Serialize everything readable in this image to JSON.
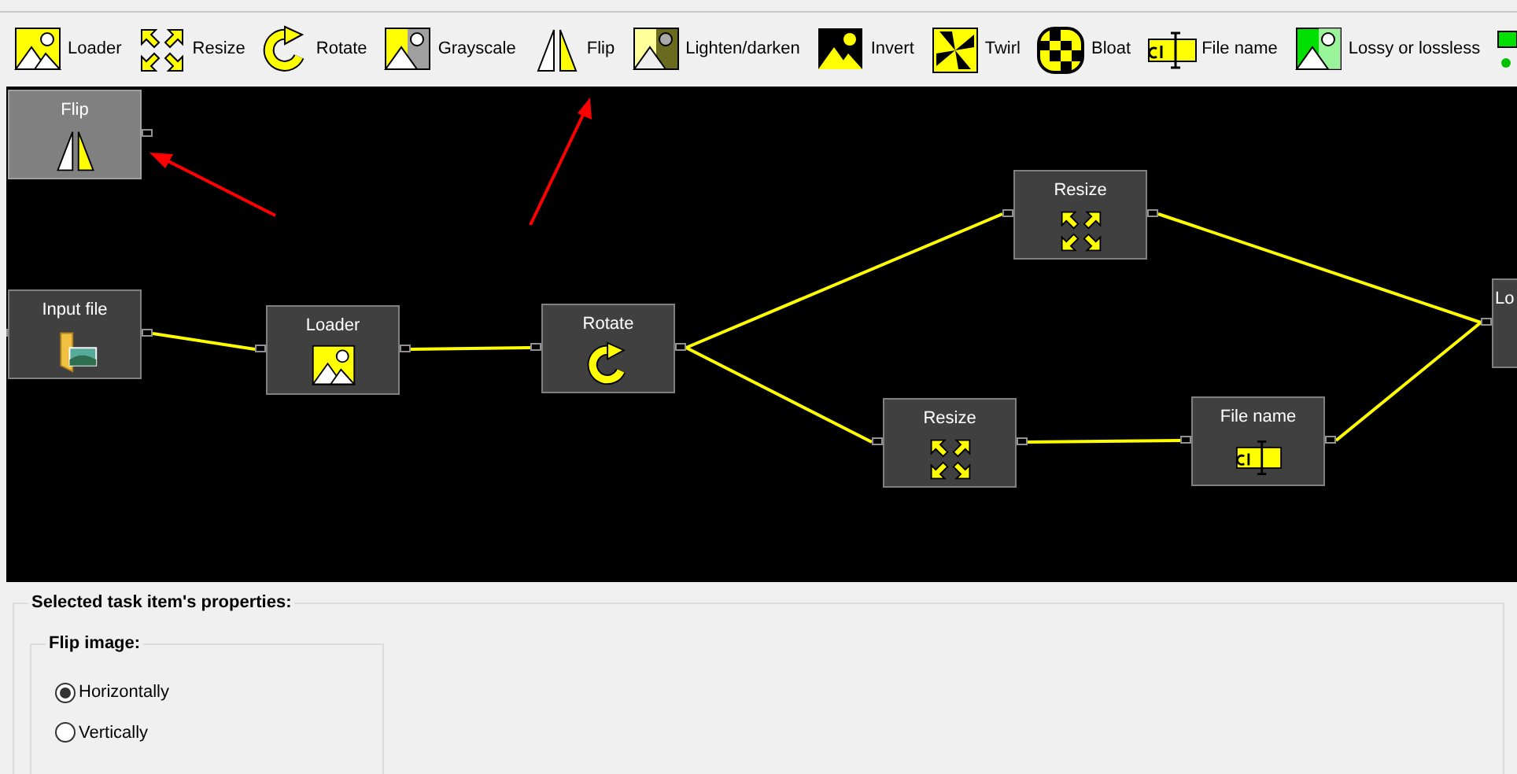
{
  "toolbar": [
    {
      "label": "Loader",
      "kind": "loader"
    },
    {
      "label": "Resize",
      "kind": "resize"
    },
    {
      "label": "Rotate",
      "kind": "rotate"
    },
    {
      "label": "Grayscale",
      "kind": "grayscale"
    },
    {
      "label": "Flip",
      "kind": "flip"
    },
    {
      "label": "Lighten/darken",
      "kind": "lighten"
    },
    {
      "label": "Invert",
      "kind": "invert"
    },
    {
      "label": "Twirl",
      "kind": "twirl"
    },
    {
      "label": "Bloat",
      "kind": "bloat"
    },
    {
      "label": "File name",
      "kind": "filename"
    },
    {
      "label": "Lossy or lossless",
      "kind": "lossy"
    },
    {
      "kind": "partial"
    }
  ],
  "canvas": {
    "nodes": [
      {
        "title": "Flip",
        "kind": "flip",
        "selected": true
      },
      {
        "title": "Input file",
        "kind": "input",
        "selected": false
      },
      {
        "title": "Loader",
        "kind": "loader",
        "selected": false
      },
      {
        "title": "Rotate",
        "kind": "rotate",
        "selected": false
      },
      {
        "title": "Resize",
        "kind": "resize",
        "selected": false
      },
      {
        "title": "Resize",
        "kind": "resize",
        "selected": false
      },
      {
        "title": "File name",
        "kind": "filename",
        "selected": false
      },
      {
        "title": "Lo",
        "kind": "cut",
        "selected": false
      }
    ]
  },
  "properties": {
    "title": "Selected task item's properties:",
    "group": {
      "title": "Flip image:",
      "options": [
        {
          "label": "Horizontally",
          "selected": true
        },
        {
          "label": "Vertically",
          "selected": false
        }
      ]
    }
  }
}
